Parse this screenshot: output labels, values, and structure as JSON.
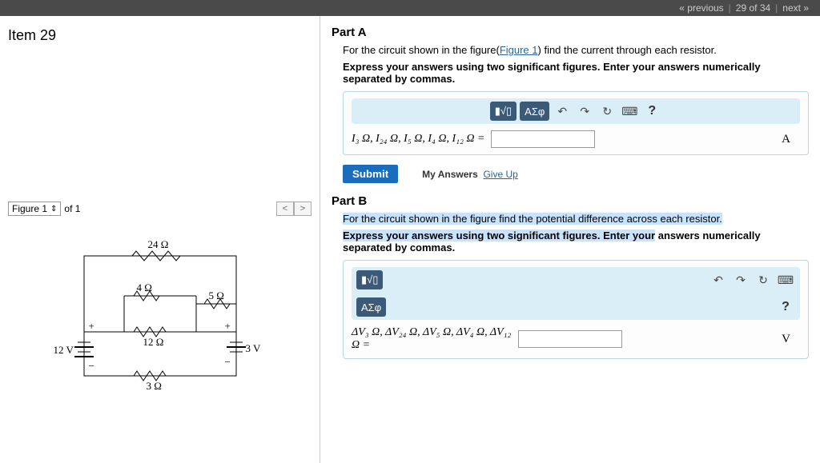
{
  "nav": {
    "prev": "« previous",
    "pos": "29 of 34",
    "next": "next »"
  },
  "item_title": "Item 29",
  "figure": {
    "sel": "Figure 1",
    "of": "of 1"
  },
  "circuit": {
    "r24": "24 Ω",
    "r4": "4 Ω",
    "r5": "5 Ω",
    "r12": "12 Ω",
    "r3": "3 Ω",
    "v12": "12 V",
    "v3": "3 V"
  },
  "partA": {
    "title": "Part A",
    "line1_a": "For the circuit shown in the figure(",
    "line1_link": "Figure 1",
    "line1_b": ") find the current through each resistor.",
    "line2": "Express your answers using two significant figures. Enter your answers numerically separated by commas.",
    "lhs": "I₃ Ω, I₂₄ Ω, I₅ Ω, I₄ Ω, I₁₂ Ω =",
    "unit": "A",
    "submit": "Submit",
    "myans": "My Answers",
    "giveup": "Give Up"
  },
  "partB": {
    "title": "Part B",
    "line1": "For the circuit shown in the figure find the potential difference across each resistor.",
    "line2_hl": "Express your answers using two significant figures. Enter your",
    "line2_rest": " answers numerically separated by commas.",
    "lhs": "ΔV₃ Ω, ΔV₂₄ Ω, ΔV₅ Ω, ΔV₄ Ω, ΔV₁₂ Ω =",
    "unit": "V"
  },
  "tb": {
    "asph": "ΑΣφ"
  }
}
